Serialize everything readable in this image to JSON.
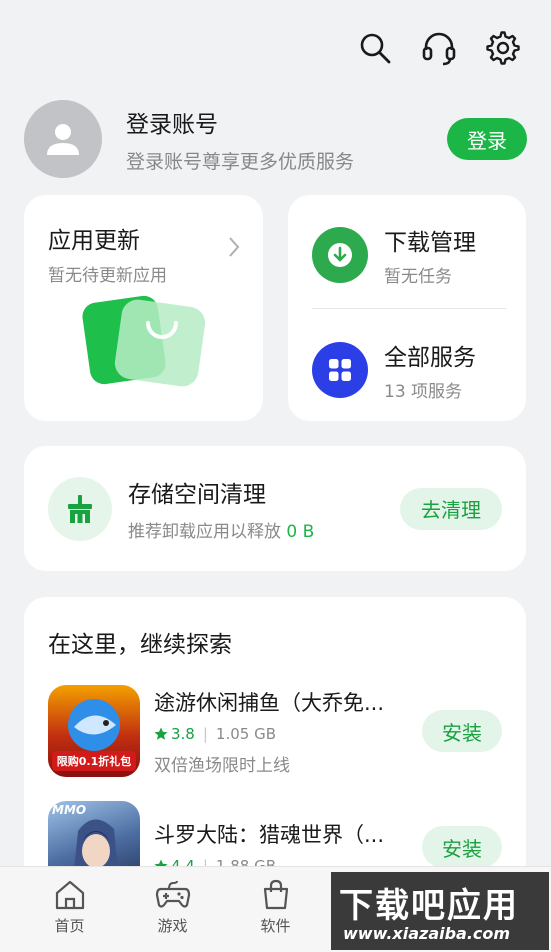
{
  "topbar": {
    "icons": [
      "search-icon",
      "customer-service-icon",
      "gear-icon"
    ]
  },
  "account": {
    "title": "登录账号",
    "subtitle": "登录账号尊享更多优质服务",
    "login_label": "登录"
  },
  "update_card": {
    "title": "应用更新",
    "subtitle": "暂无待更新应用"
  },
  "download_card": {
    "title": "下载管理",
    "subtitle": "暂无任务"
  },
  "services_card": {
    "title": "全部服务",
    "subtitle": "13 项服务"
  },
  "storage_card": {
    "title": "存储空间清理",
    "subtitle_prefix": "推荐卸载应用以释放",
    "subtitle_value": "0 B",
    "button_label": "去清理"
  },
  "explore": {
    "title": "在这里，继续探索",
    "apps": [
      {
        "name": "途游休闲捕鱼（大乔免...",
        "rating": "3.8",
        "size": "1.05 GB",
        "desc": "双倍渔场限时上线",
        "install_label": "安装",
        "icon_text": "限购0.1折礼包"
      },
      {
        "name": "斗罗大陆：猎魂世界（...",
        "rating": "4.4",
        "size": "1.88 GB",
        "install_label": "安装",
        "icon_text": "MMO"
      }
    ]
  },
  "bottom_nav": [
    {
      "label": "首页",
      "icon": "home-icon"
    },
    {
      "label": "游戏",
      "icon": "gamepad-icon"
    },
    {
      "label": "软件",
      "icon": "shopping-bag-icon"
    }
  ],
  "watermark": {
    "big": "下载吧应用",
    "small": "www.xiazaiba.com"
  },
  "colors": {
    "brand_green": "#1cb646",
    "light_green": "#e3f5e8",
    "download_green": "#2daa4e",
    "services_blue": "#2c3fe6"
  }
}
